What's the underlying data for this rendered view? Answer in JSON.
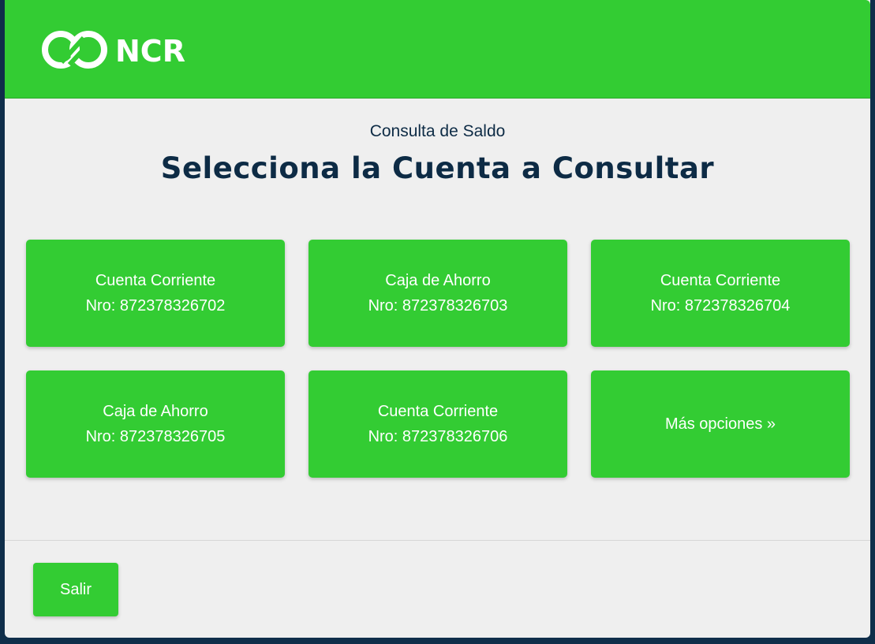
{
  "brand": {
    "name": "NCR"
  },
  "page": {
    "subtitle": "Consulta de Saldo",
    "title": "Selecciona la Cuenta a Consultar"
  },
  "accounts": [
    {
      "type": "Cuenta Corriente",
      "number": "Nro: 872378326702"
    },
    {
      "type": "Caja de Ahorro",
      "number": "Nro: 872378326703"
    },
    {
      "type": "Cuenta Corriente",
      "number": "Nro: 872378326704"
    },
    {
      "type": "Caja de Ahorro",
      "number": "Nro: 872378326705"
    },
    {
      "type": "Cuenta Corriente",
      "number": "Nro: 872378326706"
    }
  ],
  "more_options": "Más opciones »",
  "footer": {
    "exit_label": "Salir"
  },
  "colors": {
    "accent": "#33cc33",
    "text_dark": "#0d2b45",
    "background": "#efefef",
    "frame": "#0f2e4a"
  },
  "icons": {
    "logo": "ncr-logo-icon"
  }
}
